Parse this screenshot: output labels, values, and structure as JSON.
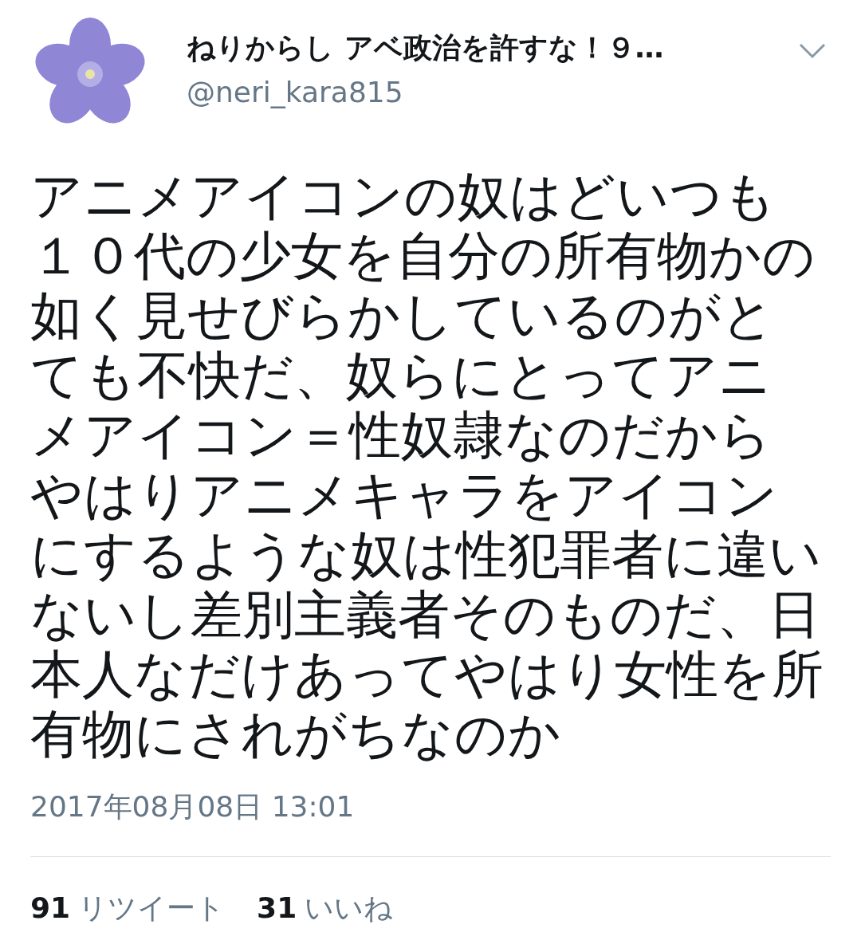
{
  "user": {
    "name": "ねりからし アベ政治を許すな！９…",
    "handle": "@neri_kara815"
  },
  "tweet": {
    "text": "アニメアイコンの奴はどいつも１０代の少女を自分の所有物かの如く見せびらかしているのがとても不快だ、奴らにとってアニメアイコン＝性奴隷なのだからやはりアニメキャラをアイコンにするような奴は性犯罪者に違いないし差別主義者そのものだ、日本人なだけあってやはり女性を所有物にされがちなのか",
    "timestamp": "2017年08月08日 13:01"
  },
  "stats": [
    {
      "count": "91",
      "label": "リツイート"
    },
    {
      "count": "31",
      "label": "いいね"
    }
  ]
}
